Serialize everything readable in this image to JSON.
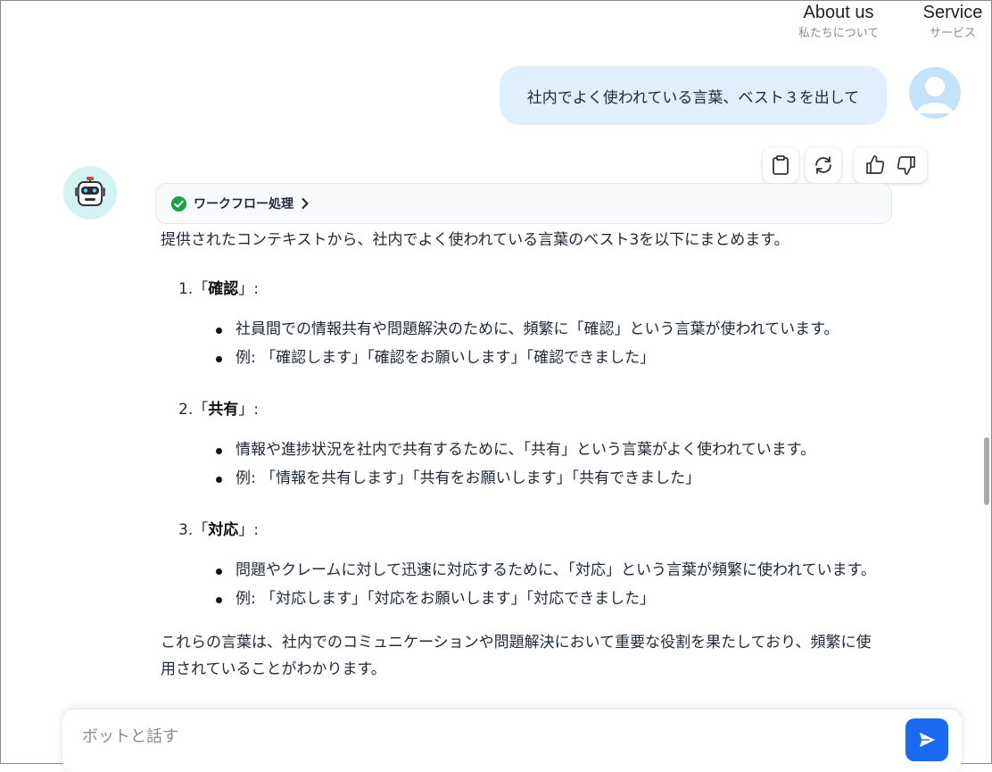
{
  "nav": {
    "about": {
      "en": "About us",
      "jp": "私たちについて"
    },
    "service": {
      "en": "Service",
      "jp": "サービス"
    }
  },
  "user_message": "社内でよく使われている言葉、ベスト３を出して",
  "workflow": {
    "label": "ワークフロー処理",
    "status": "success"
  },
  "answer": {
    "intro": "提供されたコンテキストから、社内でよく使われている言葉のベスト3を以下にまとめます。",
    "items": [
      {
        "num": "1.",
        "open": "「",
        "word": "確認",
        "close": "」:",
        "bullets": [
          "社員間での情報共有や問題解決のために、頻繁に「確認」という言葉が使われています。",
          "例: 「確認します」「確認をお願いします」「確認できました」"
        ]
      },
      {
        "num": "2.",
        "open": "「",
        "word": "共有",
        "close": "」:",
        "bullets": [
          "情報や進捗状況を社内で共有するために、「共有」という言葉がよく使われています。",
          "例: 「情報を共有します」「共有をお願いします」「共有できました」"
        ]
      },
      {
        "num": "3.",
        "open": "「",
        "word": "対応",
        "close": "」:",
        "bullets": [
          "問題やクレームに対して迅速に対応するために、「対応」という言葉が頻繁に使われています。",
          "例: 「対応します」「対応をお願いします」「対応できました」"
        ]
      }
    ],
    "outro": "これらの言葉は、社内でのコミュニケーションや問題解決において重要な役割を果たしており、頻繁に使用されていることがわかります。"
  },
  "input": {
    "placeholder": "ボットと話す",
    "value": ""
  },
  "icons": {
    "copy": "clipboard-icon",
    "regenerate": "refresh-icon",
    "like": "thumbs-up-icon",
    "dislike": "thumbs-down-icon",
    "send": "send-icon",
    "workflow_status": "check-circle-icon",
    "workflow_expand": "chevron-right-icon"
  },
  "colors": {
    "user_bubble": "#e1eefc",
    "send_button": "#1a6af2",
    "check": "#16a34a",
    "bot_avatar_bg": "#d3f3f3",
    "user_avatar_bg": "#c5e2fb"
  }
}
